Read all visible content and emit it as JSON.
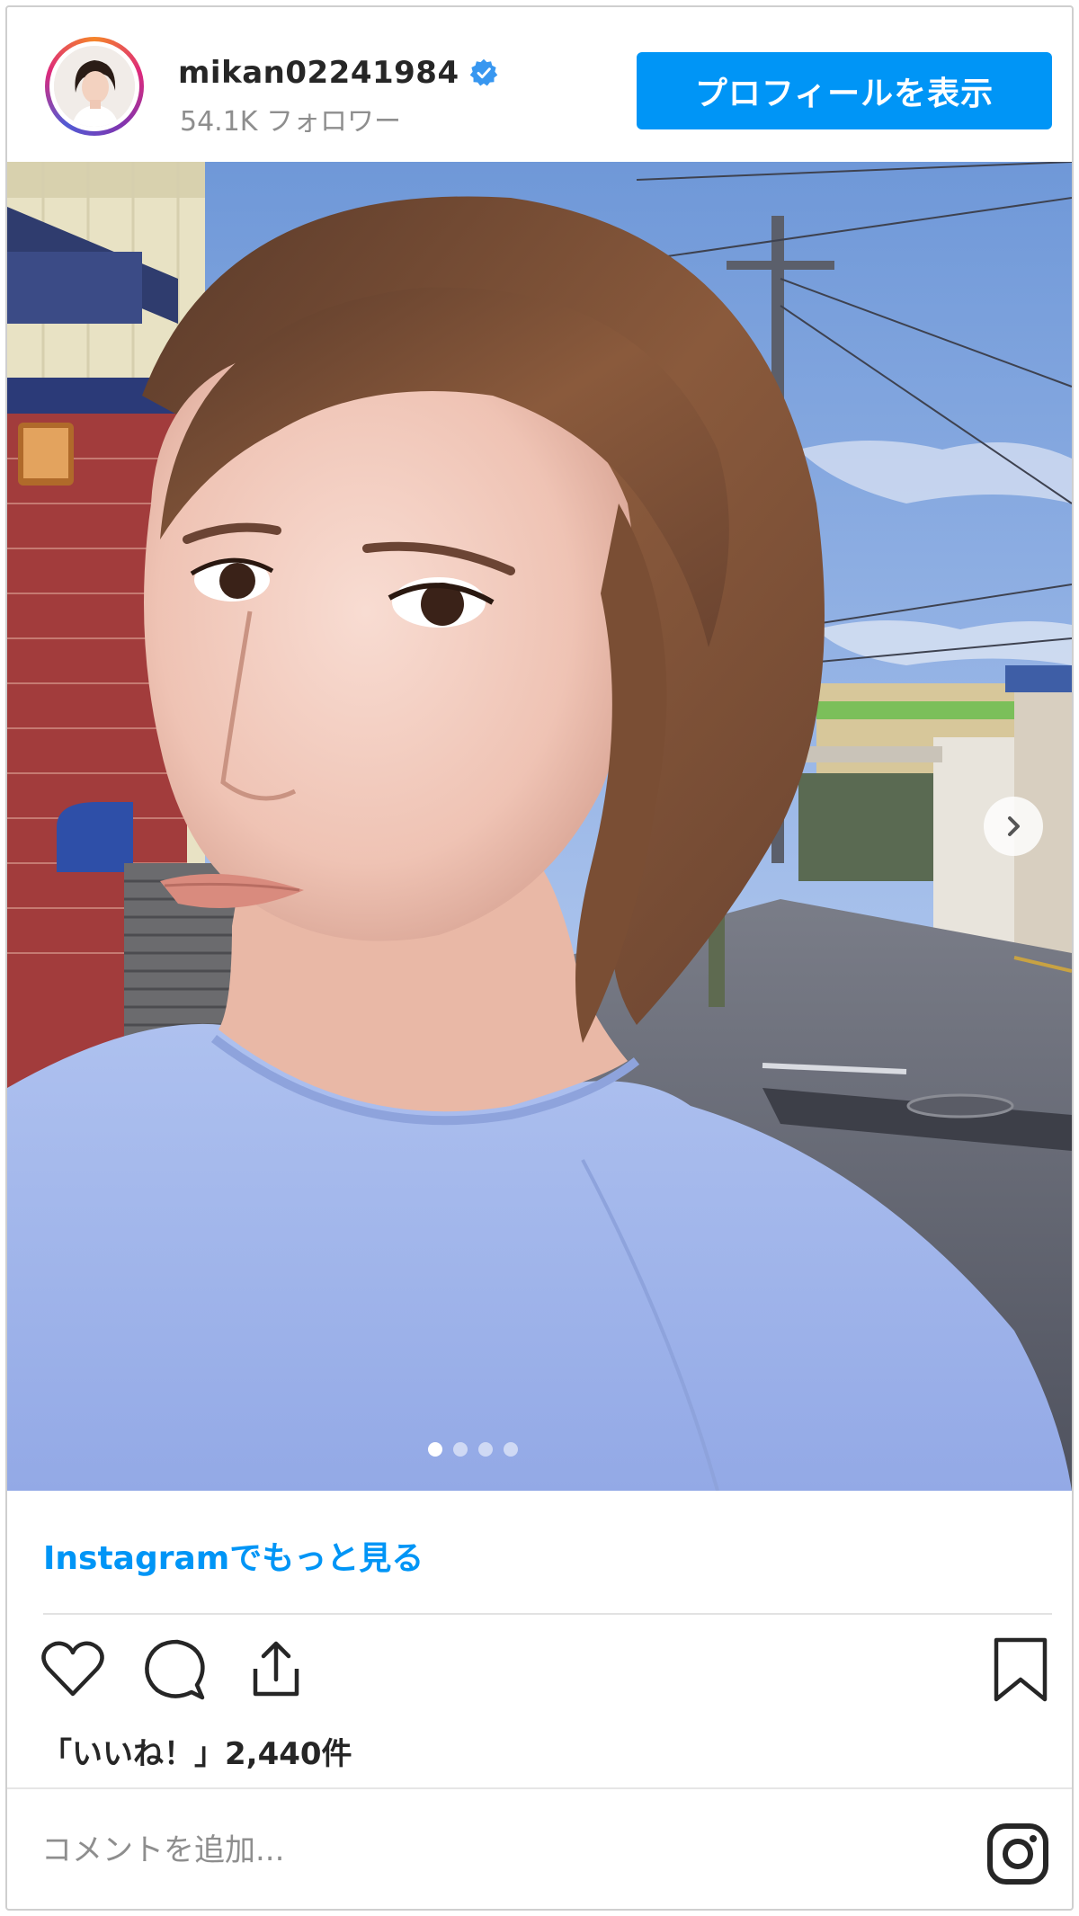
{
  "header": {
    "username": "mikan02241984",
    "followers": "54.1K フォロワー",
    "profile_button": "プロフィールを表示",
    "verified_icon": "verified-badge-icon"
  },
  "post": {
    "image_count": 4,
    "active_index": 0,
    "next_icon": "chevron-right-icon"
  },
  "more_link": "Instagramでもっと見る",
  "actions": {
    "like_icon": "heart-icon",
    "comment_icon": "comment-icon",
    "share_icon": "share-icon",
    "save_icon": "bookmark-icon"
  },
  "likes": "「いいね！」2,440件",
  "comment": {
    "placeholder": "コメントを追加..."
  },
  "colors": {
    "accent": "#0095f6",
    "text": "#262626",
    "muted": "#8e8e8e"
  }
}
